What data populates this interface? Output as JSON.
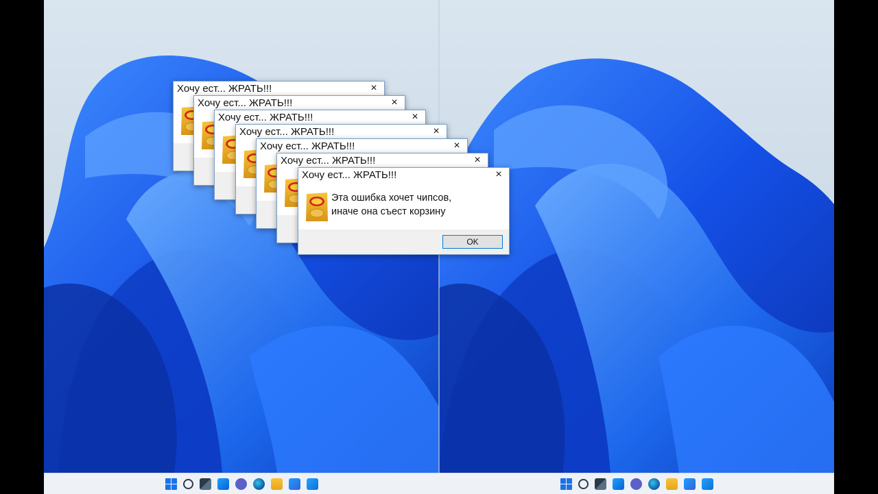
{
  "dialog": {
    "title": "Хочу ест... ЖРАТЬ!!!",
    "close_glyph": "×",
    "message_line1": "Эта ошибка хочет чипсов,",
    "message_line2": "иначе она съест корзину",
    "ok_label": "OK",
    "icon": "lays-chips-icon"
  },
  "dialog_count": 7,
  "taskbar": {
    "icons": [
      "start-icon",
      "search-icon",
      "task-view-icon",
      "widgets-icon",
      "chat-icon",
      "edge-icon",
      "file-explorer-icon",
      "store-icon",
      "mail-icon"
    ]
  },
  "colors": {
    "accent": "#0078d7",
    "wallpaper_blue": "#1a5fe0"
  }
}
